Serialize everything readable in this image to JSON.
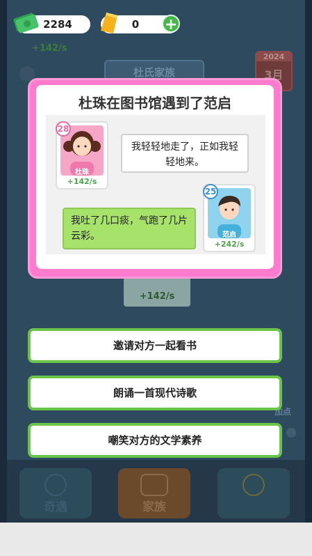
{
  "currency": {
    "money": "2284",
    "gold": "0",
    "plus": "+"
  },
  "background": {
    "income_text": "+142/s",
    "family_tag": "杜氏家族",
    "calendar_year": "2024",
    "calendar_month": "3月",
    "card_income": "+142/s",
    "side_label": "加点"
  },
  "modal": {
    "title": "杜珠在图书馆遇到了范启",
    "char_left": {
      "level": "28",
      "name": "杜珠",
      "income": "+142/s"
    },
    "char_right": {
      "level": "25",
      "name": "范启",
      "income": "+242/s"
    },
    "bubble_left": "我轻轻地走了，正如我轻轻地来。",
    "bubble_right": "我吐了几口痰，气跑了几片云彩。"
  },
  "choices": [
    "邀请对方一起看书",
    "朗诵一首现代诗歌",
    "嘲笑对方的文学素养"
  ],
  "nav": {
    "items": [
      "奇遇",
      "家族",
      ""
    ]
  },
  "colors": {
    "modal_border": "#ff7bcd",
    "choice_border": "#6ac44a",
    "bubble_green": "#a7e26b",
    "income_green": "#4da34d"
  }
}
